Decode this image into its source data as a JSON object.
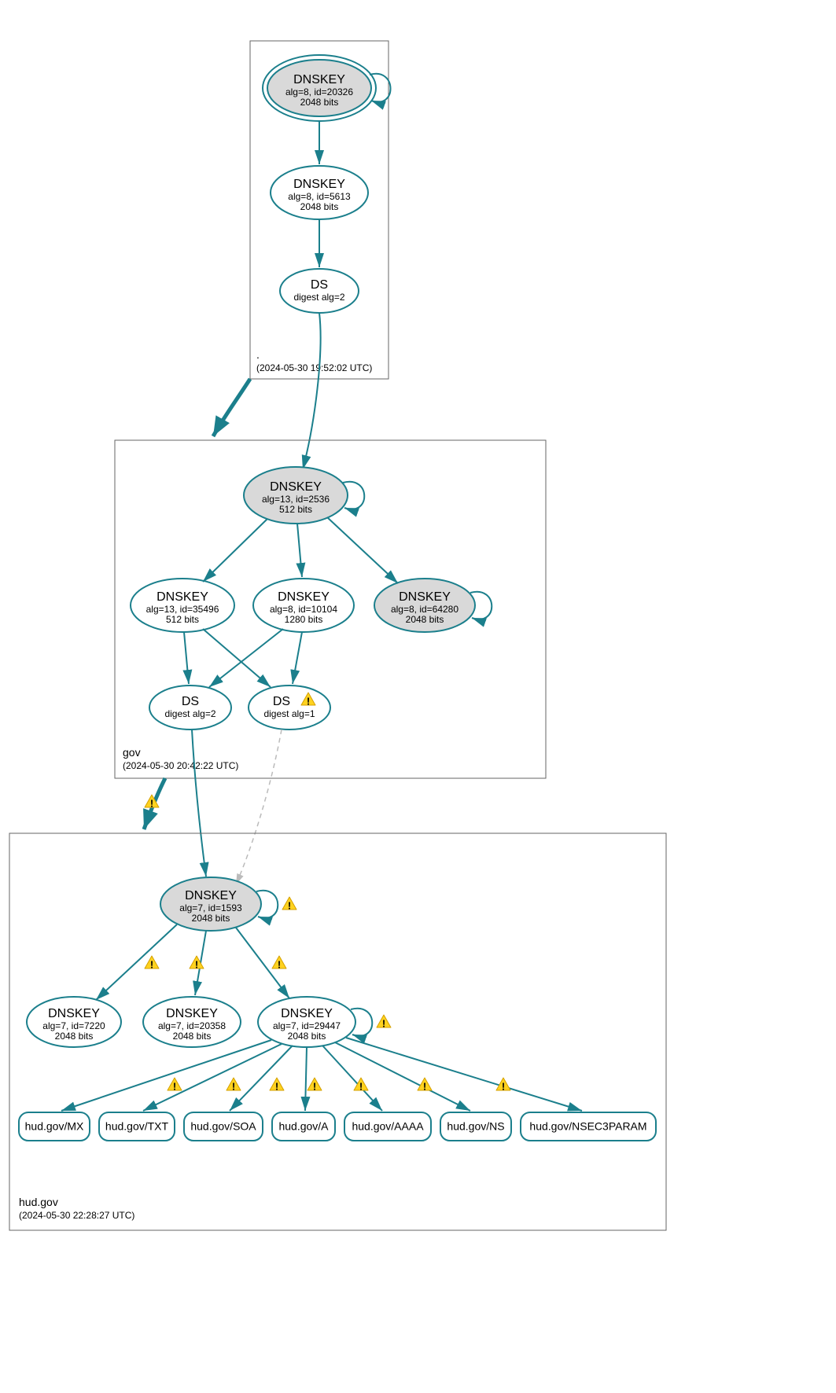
{
  "colors": {
    "stroke": "#1b7f8c",
    "node_fill": "#d9d9d9",
    "warn_fill": "#ffd21f"
  },
  "zones": {
    "root": {
      "label": ".",
      "timestamp": "(2024-05-30 19:52:02 UTC)",
      "nodes": {
        "dnskey_20326": {
          "title": "DNSKEY",
          "line1": "alg=8, id=20326",
          "line2": "2048 bits"
        },
        "dnskey_5613": {
          "title": "DNSKEY",
          "line1": "alg=8, id=5613",
          "line2": "2048 bits"
        },
        "ds_digest2": {
          "title": "DS",
          "line1": "digest alg=2"
        }
      }
    },
    "gov": {
      "label": "gov",
      "timestamp": "(2024-05-30 20:42:22 UTC)",
      "nodes": {
        "dnskey_2536": {
          "title": "DNSKEY",
          "line1": "alg=13, id=2536",
          "line2": "512 bits"
        },
        "dnskey_35496": {
          "title": "DNSKEY",
          "line1": "alg=13, id=35496",
          "line2": "512 bits"
        },
        "dnskey_10104": {
          "title": "DNSKEY",
          "line1": "alg=8, id=10104",
          "line2": "1280 bits"
        },
        "dnskey_64280": {
          "title": "DNSKEY",
          "line1": "alg=8, id=64280",
          "line2": "2048 bits"
        },
        "ds_digest2": {
          "title": "DS",
          "line1": "digest alg=2"
        },
        "ds_digest1": {
          "title": "DS",
          "line1": "digest alg=1"
        }
      }
    },
    "hudgov": {
      "label": "hud.gov",
      "timestamp": "(2024-05-30 22:28:27 UTC)",
      "nodes": {
        "dnskey_1593": {
          "title": "DNSKEY",
          "line1": "alg=7, id=1593",
          "line2": "2048 bits"
        },
        "dnskey_7220": {
          "title": "DNSKEY",
          "line1": "alg=7, id=7220",
          "line2": "2048 bits"
        },
        "dnskey_20358": {
          "title": "DNSKEY",
          "line1": "alg=7, id=20358",
          "line2": "2048 bits"
        },
        "dnskey_29447": {
          "title": "DNSKEY",
          "line1": "alg=7, id=29447",
          "line2": "2048 bits"
        }
      },
      "records": {
        "mx": "hud.gov/MX",
        "txt": "hud.gov/TXT",
        "soa": "hud.gov/SOA",
        "a": "hud.gov/A",
        "aaaa": "hud.gov/AAAA",
        "ns": "hud.gov/NS",
        "nsec3param": "hud.gov/NSEC3PARAM"
      }
    }
  },
  "warn_icon": "!"
}
